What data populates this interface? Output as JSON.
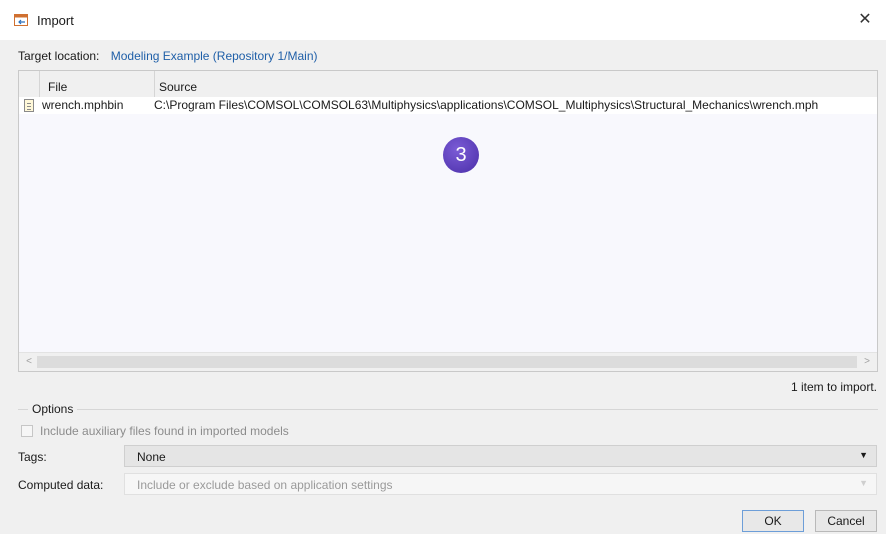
{
  "window": {
    "title": "Import",
    "close_glyph": "✕",
    "icon": "import-icon"
  },
  "target": {
    "label": "Target location:",
    "value": "Modeling Example (Repository 1/Main)"
  },
  "table": {
    "columns": [
      "File",
      "Source"
    ],
    "rows": [
      {
        "file": "wrench.mphbin",
        "source": "C:\\Program Files\\COMSOL\\COMSOL63\\Multiphysics\\applications\\COMSOL_Multiphysics\\Structural_Mechanics\\wrench.mph",
        "icon": "file-icon"
      }
    ]
  },
  "step_badge": "3",
  "import_count": "1 item to import.",
  "options": {
    "title": "Options",
    "include_aux_label": "Include auxiliary files found in imported models",
    "include_aux_checked": false,
    "tags_label": "Tags:",
    "tags_value": "None",
    "computed_label": "Computed data:",
    "computed_value": "Include or exclude based on application settings"
  },
  "buttons": {
    "ok": "OK",
    "cancel": "Cancel"
  },
  "colors": {
    "link": "#1f5fa8",
    "badge": "#5a3cbf"
  }
}
